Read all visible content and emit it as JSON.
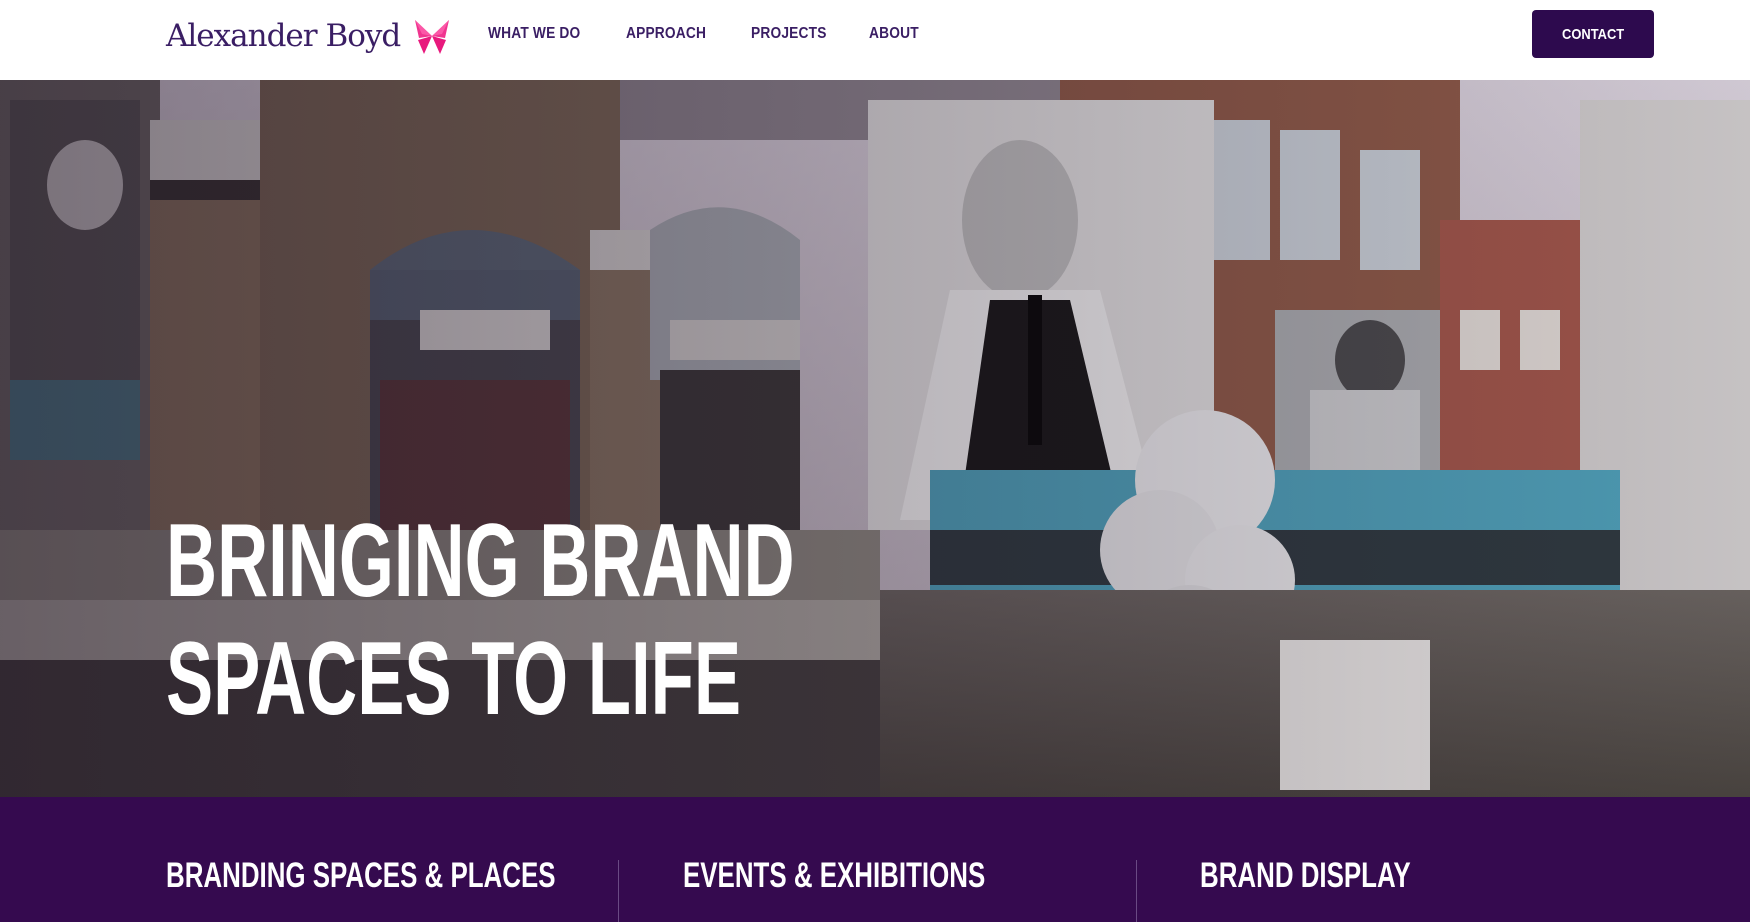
{
  "brand": {
    "name": "Alexander Boyd",
    "accent_color": "#e8197d",
    "primary_color": "#3a1e64",
    "logo_icon": "butterfly-icon"
  },
  "nav": {
    "items": [
      {
        "label": "WHAT WE DO"
      },
      {
        "label": "APPROACH"
      },
      {
        "label": "PROJECTS"
      },
      {
        "label": "ABOUT"
      }
    ],
    "cta_label": "CONTACT",
    "cta_color": "#2d0a4e"
  },
  "hero": {
    "headline_line1": "BRINGING BRAND",
    "headline_line2": "SPACES TO LIFE",
    "image_subject": "shopping-centre-interior"
  },
  "services": {
    "background_color": "#350a4f",
    "items": [
      {
        "title": "BRANDING SPACES & PLACES"
      },
      {
        "title": "EVENTS & EXHIBITIONS"
      },
      {
        "title": "BRAND DISPLAY"
      }
    ]
  }
}
